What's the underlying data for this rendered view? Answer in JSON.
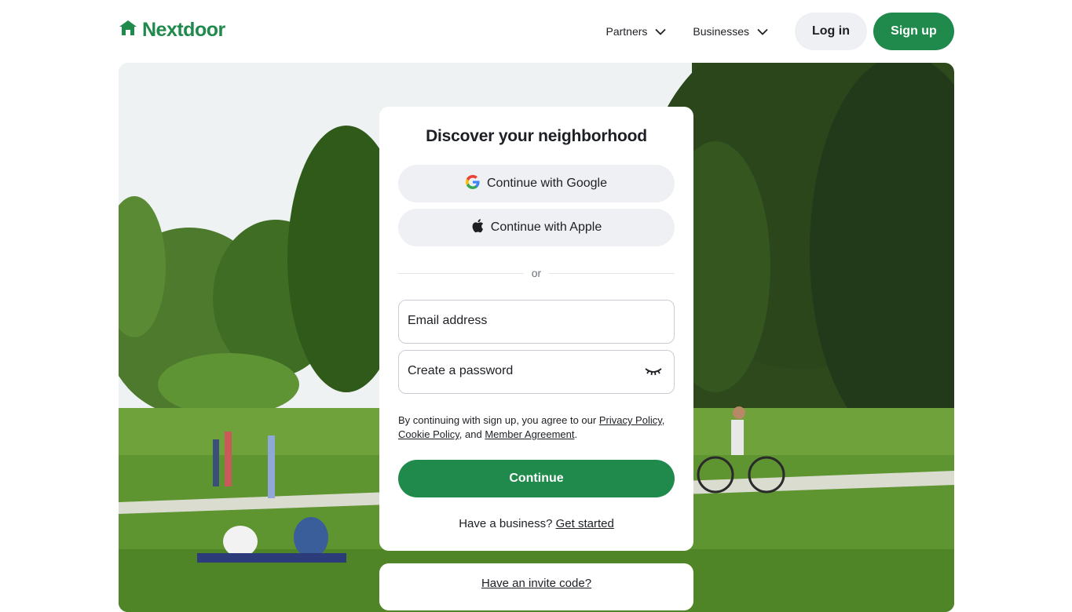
{
  "brand": {
    "name": "Nextdoor",
    "color": "#1f8a4c",
    "icon": "house-icon"
  },
  "nav": {
    "partners": "Partners",
    "businesses": "Businesses",
    "login": "Log in",
    "signup": "Sign up"
  },
  "hero": {
    "image": "park-scene-people-cycling-and-picnicking"
  },
  "signup_card": {
    "title": "Discover your neighborhood",
    "google_label": "Continue with Google",
    "apple_label": "Continue with Apple",
    "divider_text": "or",
    "email_placeholder": "Email address",
    "password_placeholder": "Create a password",
    "password_toggle_icon": "eye-closed-icon",
    "legal_prefix": "By continuing with sign up, you agree to our ",
    "privacy_link": "Privacy Policy",
    "sep1": ", ",
    "cookie_link": "Cookie Policy",
    "sep2": ", and ",
    "member_link": "Member Agreement",
    "legal_suffix": ".",
    "continue_label": "Continue",
    "business_prompt": "Have a business? ",
    "business_link": "Get started"
  },
  "invite": {
    "link": "Have an invite code?"
  }
}
